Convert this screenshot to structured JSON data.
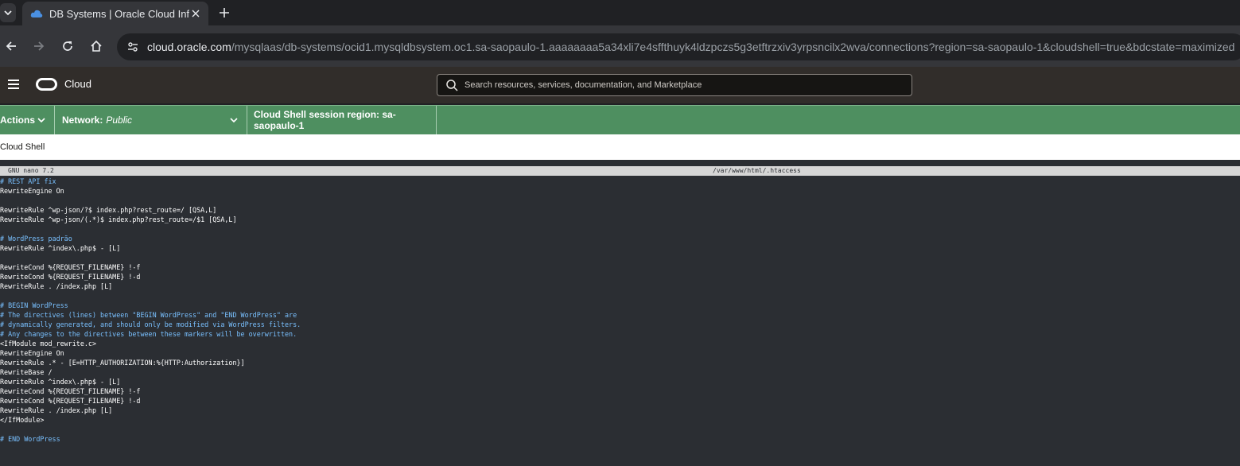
{
  "browser": {
    "tab_title": "DB Systems | Oracle Cloud Infra",
    "url_host": "cloud.oracle.com",
    "url_rest": "/mysqlaas/db-systems/ocid1.mysqldbsystem.oc1.sa-saopaulo-1.aaaaaaaa5a34xli7e4sffthuyk4ldzpczs5g3etftrzxiv3yrpsncilx2wva/connections?region=sa-saopaulo-1&cloudshell=true&bdcstate=maximized"
  },
  "oci": {
    "brand": "Cloud",
    "search_placeholder": "Search resources, services, documentation, and Marketplace"
  },
  "shell": {
    "actions_label": "Actions",
    "network_label": "Network:",
    "network_value": "Public",
    "region_label": "Cloud Shell session region: sa-saopaulo-1",
    "title": "Cloud Shell"
  },
  "nano": {
    "version": "GNU nano 7.2",
    "filename": "/var/www/html/.htaccess"
  },
  "file_lines": [
    "# REST API fix",
    "RewriteEngine On",
    "",
    "RewriteRule ^wp-json/?$ index.php?rest_route=/ [QSA,L]",
    "RewriteRule ^wp-json/(.*)$ index.php?rest_route=/$1 [QSA,L]",
    "",
    "# WordPress padrão",
    "RewriteRule ^index\\.php$ - [L]",
    "",
    "RewriteCond %{REQUEST_FILENAME} !-f",
    "RewriteCond %{REQUEST_FILENAME} !-d",
    "RewriteRule . /index.php [L]",
    "",
    "# BEGIN WordPress",
    "# The directives (lines) between \"BEGIN WordPress\" and \"END WordPress\" are",
    "# dynamically generated, and should only be modified via WordPress filters.",
    "# Any changes to the directives between these markers will be overwritten.",
    "<IfModule mod_rewrite.c>",
    "RewriteEngine On",
    "RewriteRule .* - [E=HTTP_AUTHORIZATION:%{HTTP:Authorization}]",
    "RewriteBase /",
    "RewriteRule ^index\\.php$ - [L]",
    "RewriteCond %{REQUEST_FILENAME} !-f",
    "RewriteCond %{REQUEST_FILENAME} !-d",
    "RewriteRule . /index.php [L]",
    "</IfModule>",
    "",
    "# END WordPress"
  ]
}
